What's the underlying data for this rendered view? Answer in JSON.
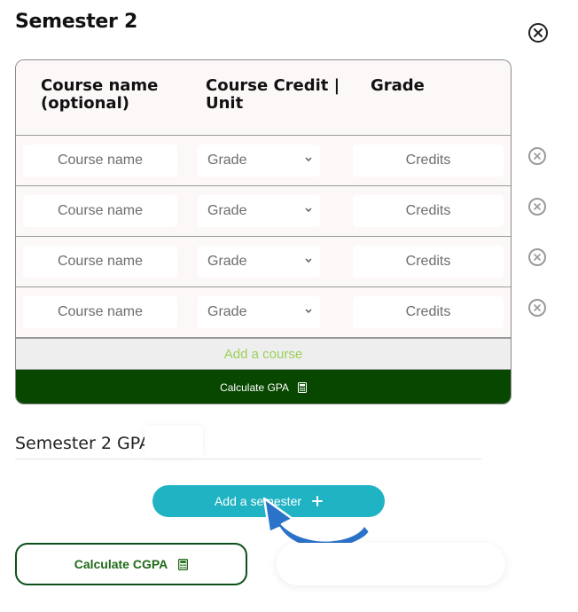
{
  "semester": {
    "title": "Semester 2"
  },
  "table": {
    "headers": [
      "Course name (optional)",
      "Course Credit | Unit",
      "Grade"
    ],
    "rows": [
      {
        "name_placeholder": "Course name",
        "grade_value": "Grade",
        "credits_placeholder": "Credits"
      },
      {
        "name_placeholder": "Course name",
        "grade_value": "Grade",
        "credits_placeholder": "Credits"
      },
      {
        "name_placeholder": "Course name",
        "grade_value": "Grade",
        "credits_placeholder": "Credits"
      },
      {
        "name_placeholder": "Course name",
        "grade_value": "Grade",
        "credits_placeholder": "Credits"
      }
    ],
    "add_course_label": "Add a course",
    "calculate_gpa_label": "Calculate GPA"
  },
  "result": {
    "semester_gpa_label": "Semester 2 GPA:",
    "semester_gpa_value": ""
  },
  "actions": {
    "add_semester_label": "Add a semester",
    "calculate_cgpa_label": "Calculate CGPA",
    "cgpa_value": ""
  },
  "colors": {
    "dark_green": "#084700",
    "teal": "#1fb3c4",
    "add_course_text": "#9ccf5a",
    "arrow_blue": "#2b73c9"
  },
  "icons": [
    "close-icon",
    "chevron-down-icon",
    "calculator-icon",
    "plus-icon",
    "pointer-arrow-icon"
  ]
}
